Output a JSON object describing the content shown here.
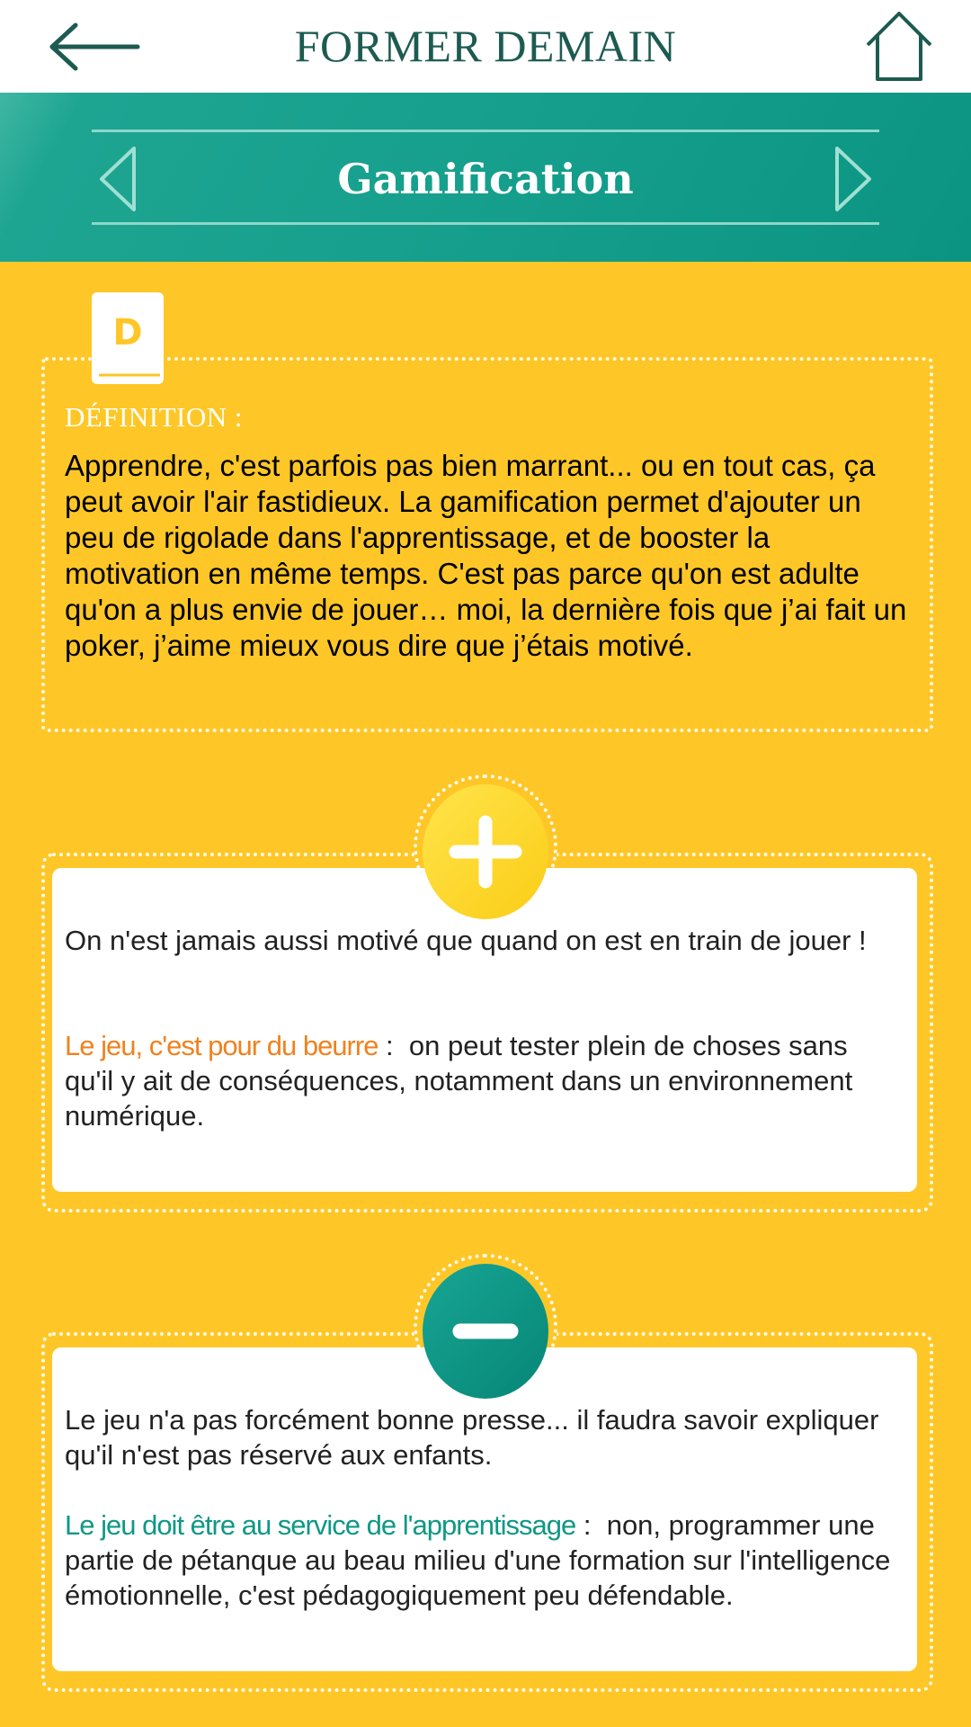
{
  "header": {
    "back_icon": "arrow-left-icon",
    "title": "FORMER DEMAIN",
    "home_icon": "home-icon"
  },
  "section": {
    "title": "Gamification",
    "prev_icon": "chevron-left-icon",
    "next_icon": "chevron-right-icon"
  },
  "definition": {
    "icon": "dictionary-book-icon",
    "icon_letter": "D",
    "label": "DÉFINITION :",
    "text": "Apprendre, c'est parfois pas bien marrant... ou en tout cas, ça peut avoir l'air fastidieux. La gamification permet d'ajouter un peu de rigolade dans l'apprentissage, et de booster la motivation en même temps. C'est pas parce qu'on est adulte qu'on a plus envie de jouer… moi, la dernière fois que j’ai fait un poker, j’aime mieux vous dire que j’étais motivé."
  },
  "pros": {
    "icon": "plus-icon",
    "intro": "On n'est jamais aussi motivé que quand on est en train de jouer !",
    "keyword": "Le jeu, c'est pour du beurre",
    "separator": " :  ",
    "detail": "on peut tester plein de choses sans qu'il y ait de conséquences, notamment dans un environnement numérique."
  },
  "cons": {
    "icon": "minus-icon",
    "intro": "Le jeu n'a pas forcément bonne presse... il faudra savoir expliquer qu'il n'est pas réservé aux enfants.",
    "keyword": "Le jeu doit être au service de l'apprentissage",
    "separator": " :  ",
    "detail": "non, programmer une partie de pétanque au beau milieu d'une formation sur l'intelligence émotionnelle, c'est pédagogiquement peu défendable."
  },
  "colors": {
    "brand_dark": "#1d5b51",
    "teal": "#16a08d",
    "yellow": "#fec727",
    "orange": "#f0821e"
  }
}
